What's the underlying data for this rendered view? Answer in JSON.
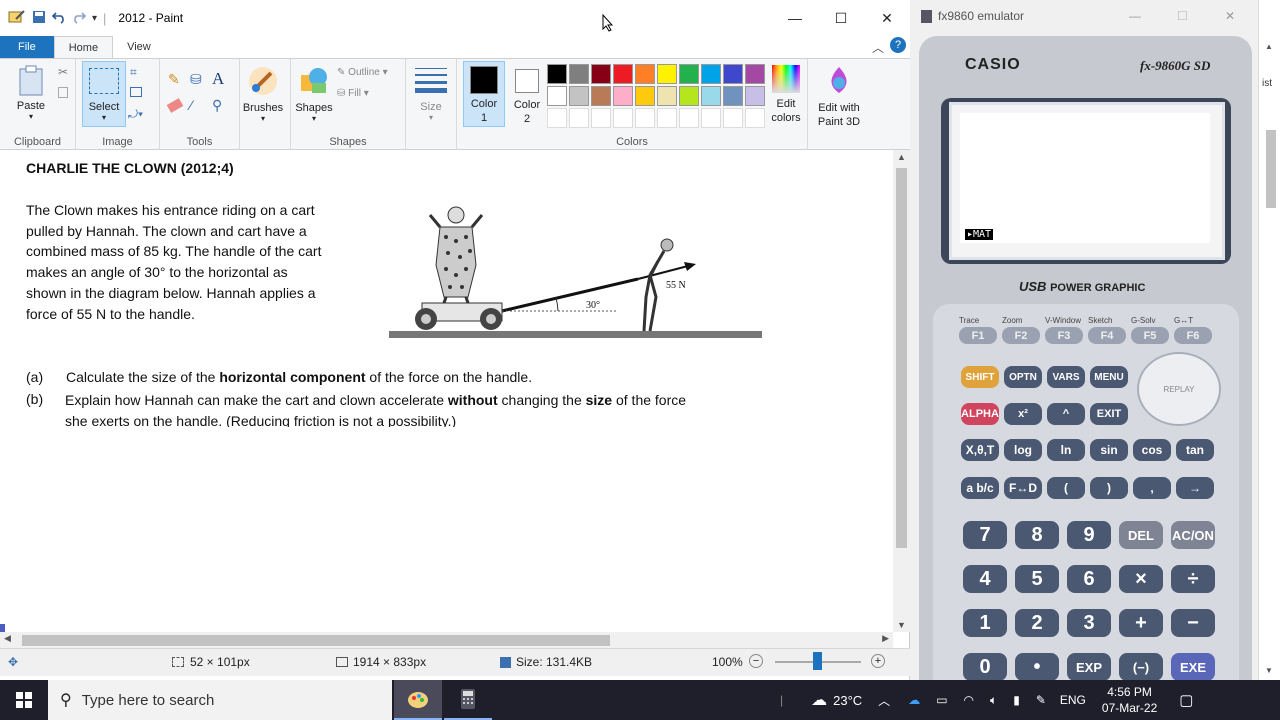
{
  "paint": {
    "title": "2012 - Paint",
    "tabs": [
      "File",
      "Home",
      "View"
    ],
    "groups": [
      "Clipboard",
      "Image",
      "Tools",
      "Shapes",
      "Colors"
    ],
    "buttons": {
      "paste": "Paste",
      "select": "Select",
      "brushes": "Brushes",
      "shapes": "Shapes",
      "outline": "Outline",
      "fill": "Fill",
      "size": "Size",
      "color1": "Color\n1",
      "color2": "Color\n2",
      "edit_colors": "Edit\ncolors",
      "edit_paint3d": "Edit with\nPaint 3D"
    },
    "palette_row1": [
      "#000000",
      "#7f7f7f",
      "#880015",
      "#ed1c24",
      "#ff7f27",
      "#fff200",
      "#22b14c",
      "#00a2e8",
      "#3f48cc",
      "#a349a4"
    ],
    "palette_row2": [
      "#ffffff",
      "#c3c3c3",
      "#b97a57",
      "#ffaec9",
      "#ffc90e",
      "#efe4b0",
      "#b5e61d",
      "#99d9ea",
      "#7092be",
      "#c8bfe7"
    ],
    "status": {
      "selection": "52 × 101px",
      "image_size": "1914 × 833px",
      "file_size": "Size: 131.4KB",
      "zoom": "100%"
    }
  },
  "doc": {
    "heading": "CHARLIE THE CLOWN (2012;4)",
    "para": [
      "The Clown makes his entrance riding on a cart",
      "pulled by Hannah. The clown and cart have a",
      "combined mass of 85 kg. The handle of the cart",
      "makes an angle of 30° to the horizontal as",
      "shown in the diagram below. Hannah applies a",
      "force of 55 N to the handle."
    ],
    "diagram_angle": "30°",
    "diagram_force": "55 N",
    "qa_label": "(a)",
    "qa_pre": "Calculate the size of the ",
    "qa_bold": "horizontal component",
    "qa_post": " of the force on the handle.",
    "qb_label": "(b)",
    "qb_pre": "Explain how Hannah can make the cart and clown accelerate ",
    "qb_bold1": "without",
    "qb_mid": " changing the ",
    "qb_bold2": "size",
    "qb_post": " of the force",
    "qb_line2": "she exerts on the handle. (Reducing friction is not a possibility.)"
  },
  "calc": {
    "window_title": "fx9860 emulator",
    "brand": "CASIO",
    "model": "fx-9860G SD",
    "screen_text": "▸MAT",
    "usb_label": "USB",
    "power_label": "POWER GRAPHIC",
    "f_labels": [
      "Trace",
      "Zoom",
      "V-Window",
      "Sketch",
      "G-Solv",
      "G↔T"
    ],
    "f_keys": [
      "F1",
      "F2",
      "F3",
      "F4",
      "F5",
      "F6"
    ],
    "row_shift": [
      "SHIFT",
      "OPTN",
      "VARS",
      "MENU"
    ],
    "row_alpha": [
      "ALPHA",
      "x²",
      "^",
      "EXIT"
    ],
    "replay": "REPLAY",
    "row_fn": [
      "X,θ,T",
      "log",
      "ln",
      "sin",
      "cos",
      "tan"
    ],
    "row_frac": [
      "a b/c",
      "F↔D",
      "(",
      ")",
      ",",
      "→"
    ],
    "row_789": [
      "7",
      "8",
      "9",
      "DEL",
      "AC/ON"
    ],
    "row_456": [
      "4",
      "5",
      "6",
      "×",
      "÷"
    ],
    "row_123": [
      "1",
      "2",
      "3",
      "+",
      "−"
    ],
    "row_0": [
      "0",
      "•",
      "EXP",
      "(−)",
      "EXE"
    ]
  },
  "taskbar": {
    "search_placeholder": "Type here to search",
    "weather": "23°C",
    "lang": "ENG",
    "time": "4:56 PM",
    "date": "07-Mar-22"
  },
  "right_strip_text": "ist"
}
